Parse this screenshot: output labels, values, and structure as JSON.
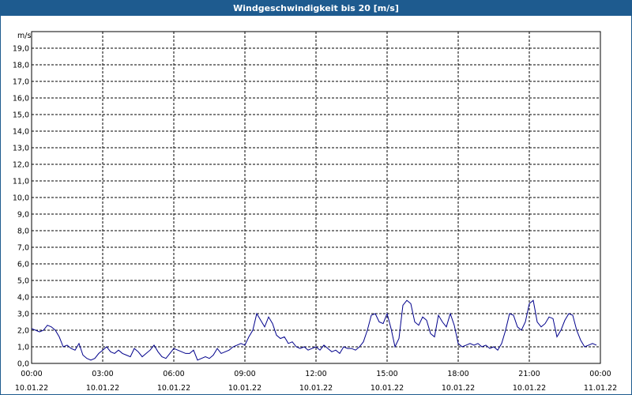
{
  "chart_data": {
    "type": "line",
    "title": "Windgeschwindigkeit bis 20 [m/s]",
    "ylabel": "m/s",
    "ylim": [
      0,
      20
    ],
    "xlim_hours": [
      0,
      24
    ],
    "grid": true,
    "yticks": [
      "0,0",
      "1,0",
      "2,0",
      "3,0",
      "4,0",
      "5,0",
      "6,0",
      "7,0",
      "8,0",
      "9,0",
      "10,0",
      "11,0",
      "12,0",
      "13,0",
      "14,0",
      "15,0",
      "16,0",
      "17,0",
      "18,0",
      "19,0"
    ],
    "xticks": [
      {
        "time": "00:00",
        "date": "10.01.22"
      },
      {
        "time": "03:00",
        "date": "10.01.22"
      },
      {
        "time": "06:00",
        "date": "10.01.22"
      },
      {
        "time": "09:00",
        "date": "10.01.22"
      },
      {
        "time": "12:00",
        "date": "10.01.22"
      },
      {
        "time": "15:00",
        "date": "10.01.22"
      },
      {
        "time": "18:00",
        "date": "10.01.22"
      },
      {
        "time": "21:00",
        "date": "10.01.22"
      },
      {
        "time": "00:00",
        "date": "11.01.22"
      }
    ],
    "series": [
      {
        "color": "#00008b",
        "x": [
          "00:00",
          "00:10",
          "00:20",
          "00:30",
          "00:40",
          "00:50",
          "01:00",
          "01:10",
          "01:20",
          "01:30",
          "01:40",
          "01:50",
          "02:00",
          "02:10",
          "02:20",
          "02:30",
          "02:40",
          "02:50",
          "03:00",
          "03:10",
          "03:20",
          "03:30",
          "03:40",
          "03:50",
          "04:00",
          "04:10",
          "04:20",
          "04:30",
          "04:40",
          "04:50",
          "05:00",
          "05:10",
          "05:20",
          "05:30",
          "05:40",
          "05:50",
          "06:00",
          "06:10",
          "06:20",
          "06:30",
          "06:40",
          "06:50",
          "07:00",
          "07:10",
          "07:20",
          "07:30",
          "07:40",
          "07:50",
          "08:00",
          "08:10",
          "08:20",
          "08:30",
          "08:40",
          "08:50",
          "09:00",
          "09:10",
          "09:20",
          "09:30",
          "09:40",
          "09:50",
          "10:00",
          "10:10",
          "10:20",
          "10:30",
          "10:40",
          "10:50",
          "11:00",
          "11:10",
          "11:20",
          "11:30",
          "11:40",
          "11:50",
          "12:00",
          "12:10",
          "12:20",
          "12:30",
          "12:40",
          "12:50",
          "13:00",
          "13:10",
          "13:20",
          "13:30",
          "13:40",
          "13:50",
          "14:00",
          "14:10",
          "14:20",
          "14:30",
          "14:40",
          "14:50",
          "15:00",
          "15:10",
          "15:20",
          "15:30",
          "15:40",
          "15:50",
          "16:00",
          "16:10",
          "16:20",
          "16:30",
          "16:40",
          "16:50",
          "17:00",
          "17:10",
          "17:20",
          "17:30",
          "17:40",
          "17:50",
          "18:00",
          "18:10",
          "18:20",
          "18:30",
          "18:40",
          "18:50",
          "19:00",
          "19:10",
          "19:20",
          "19:30",
          "19:40",
          "19:50",
          "20:00",
          "20:10",
          "20:20",
          "20:30",
          "20:40",
          "20:50",
          "21:00",
          "21:10",
          "21:20",
          "21:30",
          "21:40",
          "21:50",
          "22:00",
          "22:10",
          "22:20",
          "22:30",
          "22:40",
          "22:50",
          "23:00",
          "23:10",
          "23:20",
          "23:30",
          "23:40",
          "23:50"
        ],
        "values": [
          2.1,
          2.0,
          1.9,
          2.0,
          2.3,
          2.2,
          2.0,
          1.6,
          1.0,
          1.1,
          0.9,
          0.8,
          1.2,
          0.5,
          0.3,
          0.2,
          0.3,
          0.6,
          0.8,
          1.0,
          0.7,
          0.6,
          0.8,
          0.6,
          0.5,
          0.4,
          0.9,
          0.7,
          0.4,
          0.6,
          0.8,
          1.1,
          0.7,
          0.4,
          0.3,
          0.6,
          0.9,
          0.8,
          0.7,
          0.6,
          0.6,
          0.8,
          0.2,
          0.3,
          0.4,
          0.3,
          0.5,
          0.9,
          0.6,
          0.7,
          0.8,
          1.0,
          1.1,
          1.2,
          1.1,
          1.6,
          2.0,
          3.0,
          2.6,
          2.2,
          2.8,
          2.4,
          1.7,
          1.5,
          1.6,
          1.2,
          1.3,
          1.0,
          0.9,
          1.0,
          0.8,
          0.9,
          1.0,
          0.8,
          1.1,
          0.9,
          0.7,
          0.8,
          0.6,
          1.0,
          0.9,
          0.9,
          0.8,
          1.0,
          1.3,
          2.0,
          2.9,
          3.0,
          2.5,
          2.4,
          3.0,
          2.1,
          1.0,
          1.5,
          3.5,
          3.8,
          3.6,
          2.5,
          2.3,
          2.8,
          2.6,
          1.8,
          1.6,
          2.9,
          2.5,
          2.2,
          3.0,
          2.3,
          1.2,
          1.0,
          1.1,
          1.2,
          1.1,
          1.2,
          1.0,
          1.1,
          0.9,
          1.0,
          0.8,
          1.2,
          2.0,
          3.0,
          2.9,
          2.2,
          2.0,
          2.5,
          3.6,
          3.8,
          2.5,
          2.2,
          2.4,
          2.8,
          2.7,
          1.6,
          2.0,
          2.6,
          3.0,
          2.9,
          2.0,
          1.4,
          1.0,
          1.1,
          1.2,
          1.1
        ]
      }
    ]
  }
}
